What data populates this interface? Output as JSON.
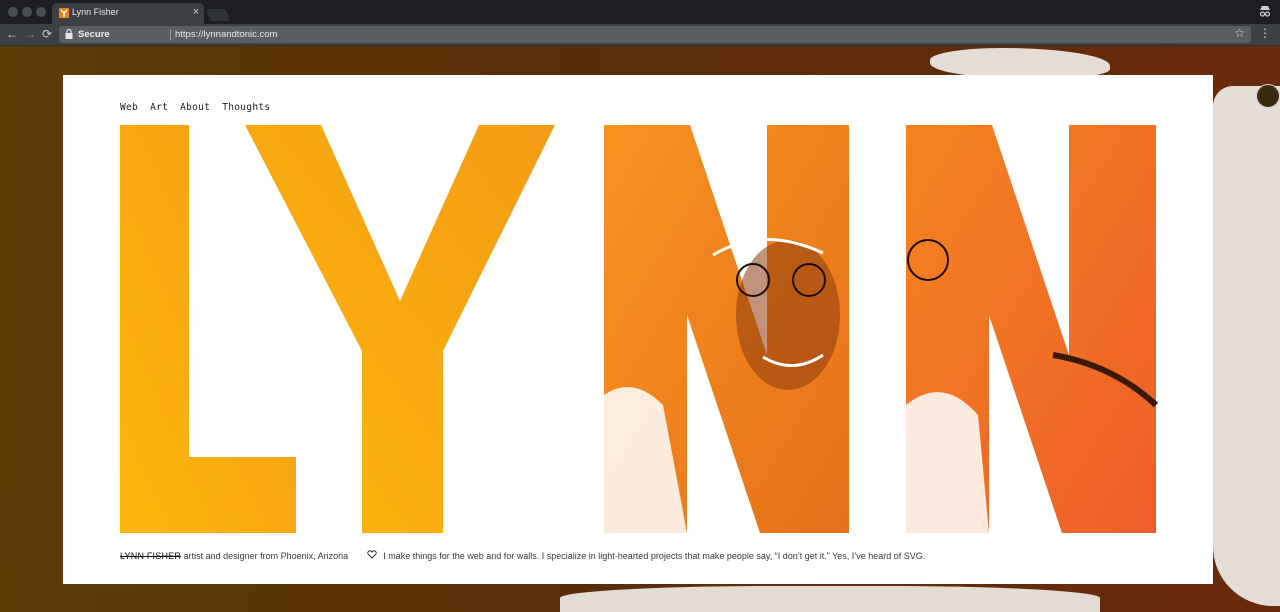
{
  "browser": {
    "tab_title": "Lynn Fisher",
    "tab_close": "×",
    "secure_label": "Secure",
    "url": "https://lynnandtonic.com",
    "back_glyph": "←",
    "forward_glyph": "→",
    "reload_glyph": "⟳",
    "star_glyph": "☆",
    "menu_glyph": "⋮"
  },
  "nav": {
    "items": [
      "Web",
      "Art",
      "About",
      "Thoughts"
    ]
  },
  "hero": {
    "letters": [
      "L",
      "Y",
      "N",
      "N"
    ]
  },
  "footer": {
    "name": "LYNN FISHER",
    "tagline": "artist and designer from Phoenix, Arizona",
    "bio": "I make things for the web and for walls. I specialize in light-hearted projects that make people say, “I don’t get it.” Yes, I’ve heard of SVG."
  },
  "colors": {
    "accent_yellow": "#fdb20a",
    "accent_orange": "#f2821e",
    "accent_red_orange": "#f0612a",
    "chrome_dark": "#1c1e21",
    "chrome_mid": "#3c3f44"
  },
  "icons": [
    "favicon-icon",
    "lock-icon",
    "star-icon",
    "menu-icon",
    "incognito-icon",
    "heart-icon",
    "extension-icon"
  ]
}
